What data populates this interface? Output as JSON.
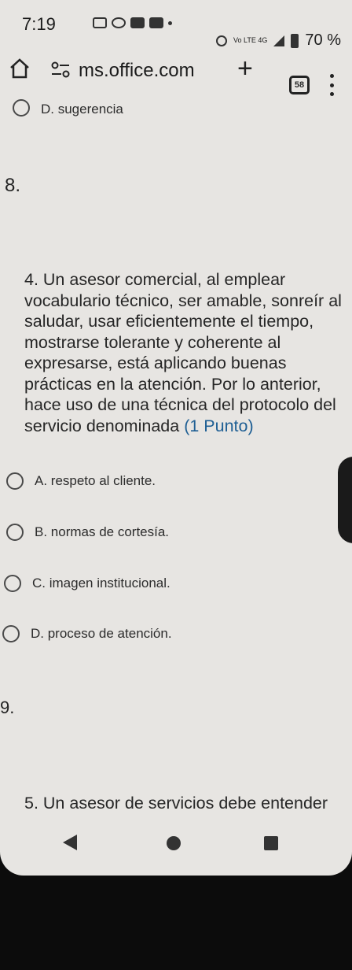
{
  "status_bar": {
    "time": "7:19",
    "network": "Vo LTE 4G",
    "battery": "70 %"
  },
  "browser": {
    "url": "ms.office.com",
    "tab_count": "58"
  },
  "previous_option": {
    "label": "D. sugerencia"
  },
  "question_8": {
    "number": "8.",
    "text": "4. Un asesor comercial, al emplear vocabulario técnico, ser amable, sonreír al saludar, usar eficientemente el tiempo, mostrarse tolerante y coherente al expresarse, está aplicando buenas prácticas en la atención. Por lo anterior, hace uso de una técnica del protocolo del servicio denominada",
    "points": "(1 Punto)",
    "options": [
      {
        "label": "A. respeto al cliente."
      },
      {
        "label": "B. normas de cortesía."
      },
      {
        "label": "C. imagen institucional."
      },
      {
        "label": "D. proceso de atención."
      }
    ]
  },
  "next_question": {
    "number": "9.",
    "text_start": "5. Un asesor de servicios debe entender"
  }
}
